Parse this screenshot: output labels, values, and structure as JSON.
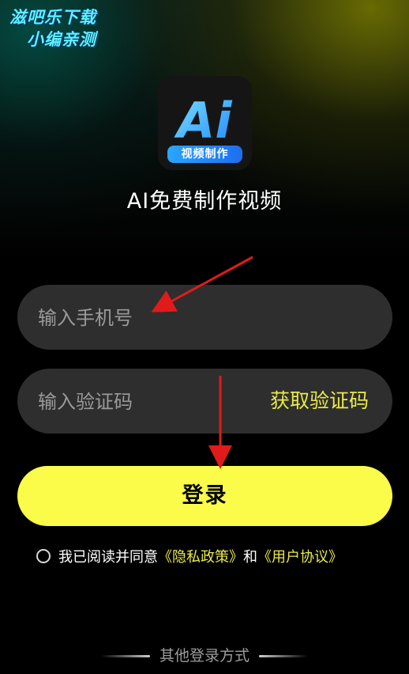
{
  "watermark": {
    "line1": "滋吧乐下载",
    "line2": "小编亲测"
  },
  "logo": {
    "text": "Ai",
    "subtitle": "视频制作"
  },
  "app_title": "AI免费制作视频",
  "phone_field": {
    "placeholder": "输入手机号",
    "value": ""
  },
  "code_field": {
    "placeholder": "输入验证码",
    "value": "",
    "get_code_label": "获取验证码"
  },
  "login_label": "登录",
  "agreement": {
    "prefix": "我已阅读并同意",
    "privacy_link": "《隐私政策》",
    "and": "和",
    "terms_link": "《用户协议》"
  },
  "other_login_label": "其他登录方式",
  "colors": {
    "accent": "#fafc49",
    "link": "#e9ea4a",
    "field_bg": "#2e2e2e",
    "arrow": "#e01b1b"
  }
}
